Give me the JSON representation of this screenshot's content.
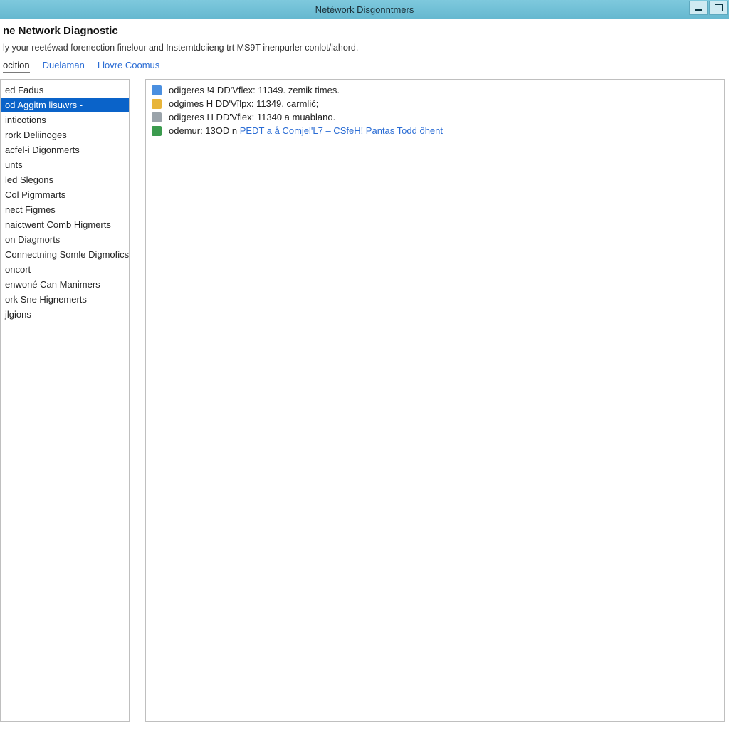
{
  "window": {
    "title": "Netéwork Disgonntmers"
  },
  "header": {
    "title": "ne Network Diagnostic",
    "description": "ly your reetéwad forenection finelour and Insterntdciieng trt MS9T inenpurler conlot/lahord."
  },
  "tabs": {
    "items": [
      {
        "label": "ocition",
        "active": true
      },
      {
        "label": "Duelaman",
        "active": false
      },
      {
        "label": "Llovre Coomus",
        "active": false
      }
    ]
  },
  "sidebar": {
    "items": [
      {
        "label": "ed Fadus",
        "selected": false
      },
      {
        "label": "od Aggitm lisuwrs -",
        "selected": true
      },
      {
        "label": "inticotions",
        "selected": false
      },
      {
        "label": "rork Deliinoges",
        "selected": false
      },
      {
        "label": "acfel-i Digonmerts",
        "selected": false
      },
      {
        "label": "unts",
        "selected": false
      },
      {
        "label": "led Slegons",
        "selected": false
      },
      {
        "label": "Col Pigmmarts",
        "selected": false
      },
      {
        "label": "nect Figmes",
        "selected": false
      },
      {
        "label": "naictwent Comb Higmerts",
        "selected": false
      },
      {
        "label": "on Diagmorts",
        "selected": false
      },
      {
        "label": "Connectning Somle Digmofics",
        "selected": false
      },
      {
        "label": "oncort",
        "selected": false
      },
      {
        "label": "enwoné Can Manimers",
        "selected": false
      },
      {
        "label": "ork Sne Hignemerts",
        "selected": false
      },
      {
        "label": "jlgions",
        "selected": false
      }
    ]
  },
  "log": {
    "entries": [
      {
        "icon": "blue",
        "icon_name": "info-icon",
        "text": "odigeres !4 DD'Vflex: 11349. zemik times."
      },
      {
        "icon": "yellow",
        "icon_name": "warning-icon",
        "text": "odgimes H DD'Vîlpx: 11349. carmlić;"
      },
      {
        "icon": "gray",
        "icon_name": "log-icon",
        "text": "odigeres H DD'Vflex: 11340 a muablano."
      },
      {
        "icon": "green",
        "icon_name": "success-icon",
        "text_prefix": "odemur: 13OD n ",
        "link_text": "PEDT a å Comjel'L7 – CSfeH! Pantas Todd ôhent"
      }
    ]
  }
}
